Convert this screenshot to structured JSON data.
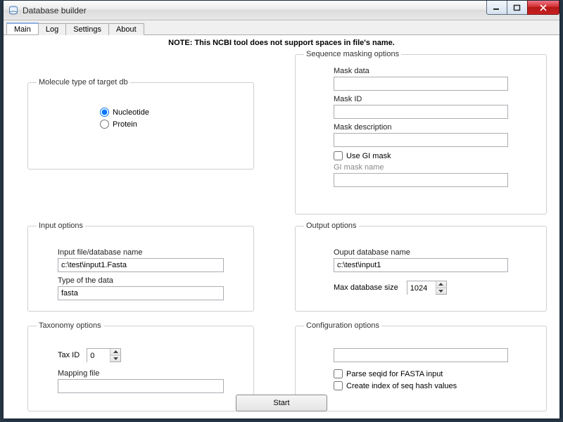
{
  "window": {
    "title": "Database builder"
  },
  "tabs": [
    "Main",
    "Log",
    "Settings",
    "About"
  ],
  "active_tab": 0,
  "note": "NOTE: This NCBI tool does not support spaces in file's name.",
  "molecule": {
    "legend": "Molecule type of target db",
    "nucleotide_label": "Nucleotide",
    "protein_label": "Protein",
    "selected": "nucleotide"
  },
  "masking": {
    "legend": "Sequence masking options",
    "mask_data_label": "Mask data",
    "mask_data": "",
    "mask_id_label": "Mask ID",
    "mask_id": "",
    "mask_desc_label": "Mask description",
    "mask_desc": "",
    "use_gi_mask_label": "Use GI mask",
    "use_gi_mask": false,
    "gi_mask_name_label": "GI mask name",
    "gi_mask_name": ""
  },
  "input": {
    "legend": "Input options",
    "file_label": "Input file/database name",
    "file_value": "c:\\test\\input1.Fasta",
    "type_label": "Type of the data",
    "type_value": "fasta"
  },
  "output": {
    "legend": "Output options",
    "name_label": "Ouput database name",
    "name_value": "c:\\test\\input1",
    "maxsize_label": "Max database size",
    "maxsize_value": "1024"
  },
  "taxonomy": {
    "legend": "Taxonomy options",
    "taxid_label": "Tax ID",
    "taxid_value": "0",
    "mapping_label": "Mapping file",
    "mapping_value": ""
  },
  "config": {
    "legend": "Configuration options",
    "extra_value": "",
    "parse_seqid_label": "Parse seqid for FASTA input",
    "parse_seqid": false,
    "hash_index_label": "Create index of seq hash values",
    "hash_index": false
  },
  "start_label": "Start"
}
